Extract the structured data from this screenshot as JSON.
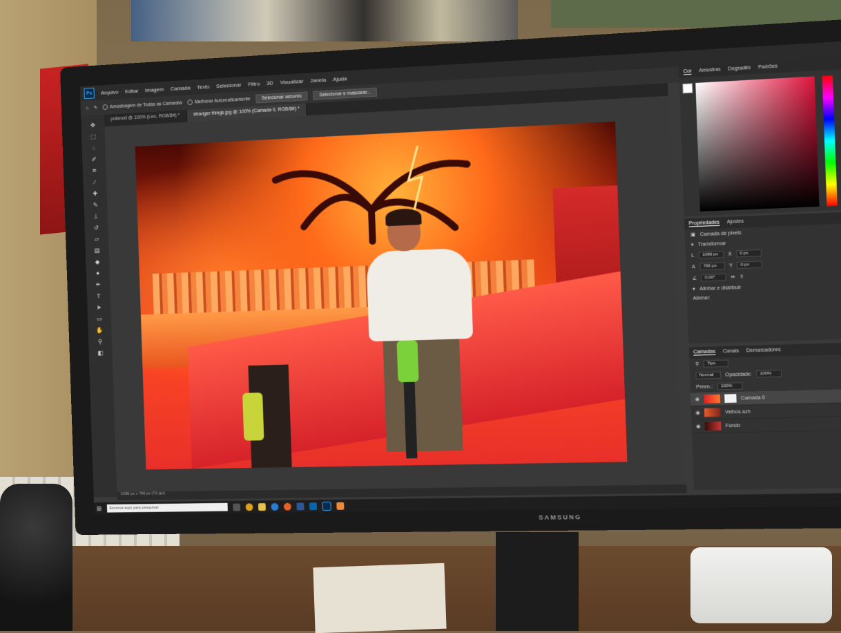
{
  "monitor": {
    "brand": "SAMSUNG"
  },
  "photoshop": {
    "menu": [
      "Arquivo",
      "Editar",
      "Imagem",
      "Camada",
      "Texto",
      "Selecionar",
      "Filtro",
      "3D",
      "Visualizar",
      "Janela",
      "Ajuda"
    ],
    "options": {
      "sample_all_layers": "Amostragem de Todas as Camadas",
      "enhance_auto": "Melhorar Automaticamente",
      "select_subject": "Selecionar assunto",
      "select_mask": "Selecionar e mascarar..."
    },
    "tabs": [
      {
        "label": "polaroid @ 100% (Leo, RGB/8#) *"
      },
      {
        "label": "stranger things.jpg @ 100% (Camada 0, RGB/8#) *"
      }
    ],
    "color_panel": {
      "tabs": [
        "Cor",
        "Amostras",
        "Degradês",
        "Padrões"
      ]
    },
    "properties_panel": {
      "tabs": [
        "Propriedades",
        "Ajustes"
      ],
      "layer_type": "Camada de pixels",
      "section_transform": "Transformar",
      "w": "1096 px",
      "h": "766 px",
      "x": "0 px",
      "y": "0 px",
      "angle": "0,00°",
      "section_align": "Alinhar e distribuir",
      "align_label": "Alinhar:"
    },
    "layers_panel": {
      "tabs": [
        "Camadas",
        "Canais",
        "Demarcadores"
      ],
      "filter": "Tipo",
      "blend_mode": "Normal",
      "opacity_label": "Opacidade:",
      "opacity": "100%",
      "fill_label": "Preen.:",
      "fill": "100%",
      "layers": [
        {
          "name": "Camada 0"
        },
        {
          "name": "Velhos azh"
        },
        {
          "name": "Fundo"
        }
      ]
    },
    "status": "1096 px x 766 px (72 ppi)"
  },
  "taskbar": {
    "search_placeholder": "Escreva aqui para pesquisar"
  }
}
